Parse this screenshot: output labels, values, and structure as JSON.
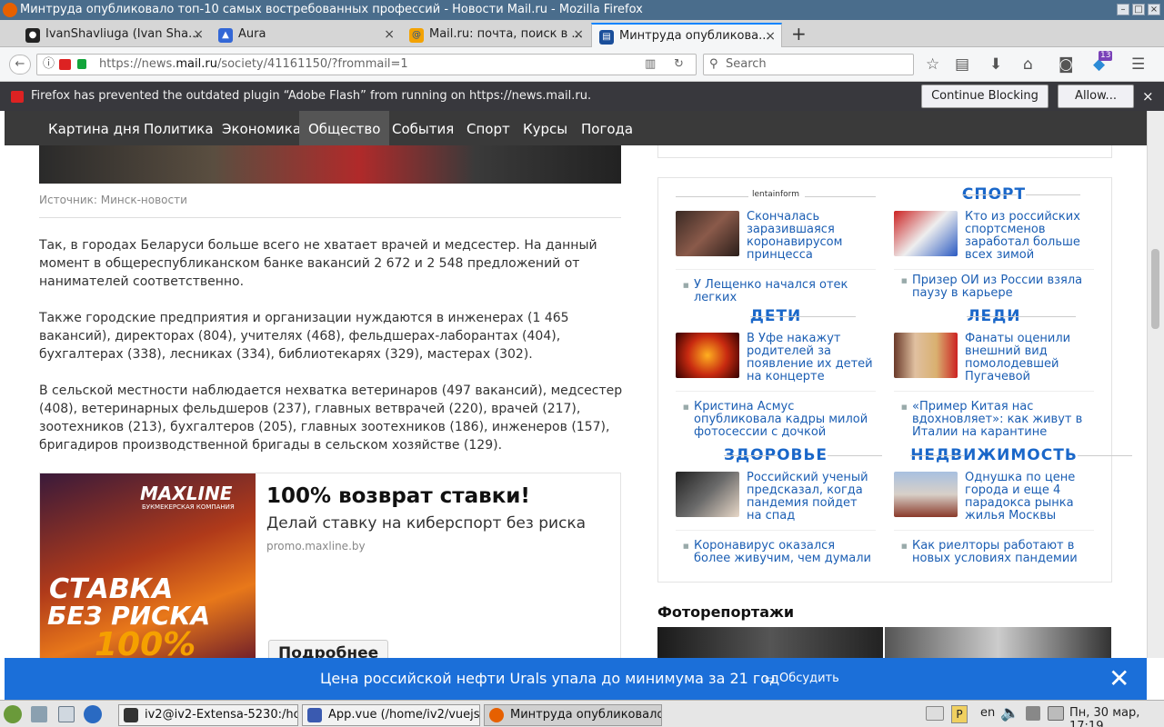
{
  "window": {
    "title": "Минтруда опубликовало топ-10 самых востребованных профессий - Новости Mail.ru - Mozilla Firefox"
  },
  "tabs": [
    {
      "label": "IvanShavliuga (Ivan Sha..."
    },
    {
      "label": "Aura"
    },
    {
      "label": "Mail.ru: почта, поиск в ..."
    },
    {
      "label": "Минтруда опубликова..."
    }
  ],
  "nav": {
    "url_prefix": "https://news.",
    "url_domain": "mail.ru",
    "url_path": "/society/41161150/?frommail=1",
    "search_placeholder": "Search",
    "badge_count": "13"
  },
  "notification": {
    "message": "Firefox has prevented the outdated plugin “Adobe Flash” from running on https://news.mail.ru.",
    "continue_label": "Continue Blocking",
    "allow_label": "Allow..."
  },
  "sitenav": {
    "items": [
      "Картина дня",
      "Политика",
      "Экономика",
      "Общество",
      "События",
      "Спорт",
      "Курсы",
      "Погода"
    ]
  },
  "article": {
    "source": "Источник: Минск-новости",
    "paragraphs": [
      "Так, в городах Беларуси больше всего не хватает врачей и медсестер. На данный момент в общереспубликанском банке вакансий 2 672 и 2 548 предложений от нанимателей соответственно.",
      "Также городские предприятия и организации нуждаются в инженерах (1 465 вакансий), директорах (804), учителях (468), фельдшерах-лаборантах (404), бухгалтерах (338), лесниках (334), библиотекарях (329), мастерах (302).",
      "В сельской местности наблюдается нехватка ветеринаров (497 вакансий), медсестер (408), ветеринарных фельдшеров (237), главных ветврачей (220), врачей (217), зоотехников (213), бухгалтеров (205), главных зоотехников (186), инженеров (157), бригадиров производственной бригады в сельском хозяйстве (129)."
    ]
  },
  "ad": {
    "brand": "MAXLINE",
    "brand_sub": "БУКМЕКЕРСКАЯ КОМПАНИЯ",
    "image_text1": "СТАВКА",
    "image_text2": "БЕЗ РИСКА",
    "image_text3": "100%",
    "title": "100% возврат ставки!",
    "subtitle": "Делай ставку на киберспорт без риска",
    "domain": "promo.maxline.by",
    "button": "Подробнее"
  },
  "sidebar": {
    "lentainform": "lentainform",
    "sections": [
      {
        "title": "СПОРТ"
      },
      {
        "title": "ДЕТИ"
      },
      {
        "title": "ЛЕДИ"
      },
      {
        "title": "ЗДОРОВЬЕ"
      },
      {
        "title": "НЕДВИЖИМОСТЬ"
      }
    ],
    "cards": [
      "Скончалась заразившаяся коронавирусом принцесса",
      "Кто из российских спортсменов заработал больше всех зимой",
      "В Уфе накажут родителей за появление их детей на концерте",
      "Фанаты оценили внешний вид помолодевшей Пугачевой",
      "Российский ученый предсказал, когда пандемия пойдет на спад",
      "Однушка по цене города и еще 4 парадокса рынка жилья Москвы"
    ],
    "bullets": [
      "У Лещенко начался отек легких",
      "Призер ОИ из России взяла паузу в карьере",
      "Кристина Асмус опубликовала кадры милой фотосессии с дочкой",
      "«Пример Китая нас вдохновляет»: как живут в Италии на карантине",
      "Коронавирус оказался более живучим, чем думали",
      "Как риелторы работают в новых условиях пандемии"
    ],
    "photo_heading": "Фоторепортажи"
  },
  "banner": {
    "text": "Цена российской нефти Urals упала до минимума за 21 год",
    "discuss": "Обсудить"
  },
  "taskbar": {
    "items": [
      "iv2@iv2-Extensa-5230:/ho...",
      "App.vue (/home/iv2/vuejs...",
      "Минтруда опубликовало..."
    ],
    "lang": "en",
    "clock": "Пн, 30 мар, 17:19"
  }
}
